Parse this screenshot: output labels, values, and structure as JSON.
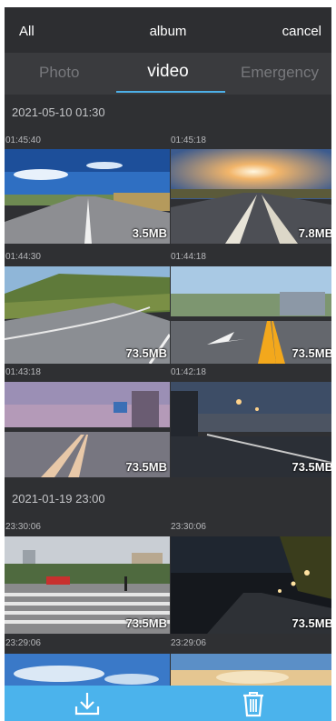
{
  "header": {
    "all_label": "All",
    "title": "album",
    "cancel_label": "cancel"
  },
  "tabs": [
    {
      "label": "Photo",
      "active": false
    },
    {
      "label": "video",
      "active": true
    },
    {
      "label": "Emergency",
      "active": false
    }
  ],
  "groups": [
    {
      "date": "2021-05-10 01:30",
      "clips": [
        {
          "time": "01:45:40",
          "size": "3.5MB",
          "scene": "road-blue-sky"
        },
        {
          "time": "01:45:18",
          "size": "7.8MB",
          "scene": "road-sunset"
        },
        {
          "time": "01:44:30",
          "size": "73.5MB",
          "scene": "road-hill-curve"
        },
        {
          "time": "01:44:18",
          "size": "73.5MB",
          "scene": "road-yellow-line"
        },
        {
          "time": "01:43:18",
          "size": "73.5MB",
          "scene": "road-dusk-city"
        },
        {
          "time": "01:42:18",
          "size": "73.5MB",
          "scene": "road-night-lights"
        }
      ]
    },
    {
      "date": "2021-01-19 23:00",
      "clips": [
        {
          "time": "23:30:06",
          "size": "73.5MB",
          "scene": "crosswalk"
        },
        {
          "time": "23:30:06",
          "size": "73.5MB",
          "scene": "night-street"
        },
        {
          "time": "23:29:06",
          "size": "",
          "scene": "sky-partial"
        },
        {
          "time": "23:29:06",
          "size": "",
          "scene": "sky-partial-warm"
        }
      ]
    }
  ],
  "toolbar": {
    "download_icon": "download-icon",
    "delete_icon": "trash-icon"
  },
  "colors": {
    "accent": "#4bb3ec",
    "background": "#2f3033",
    "tab_bar": "#3a3b3e"
  }
}
